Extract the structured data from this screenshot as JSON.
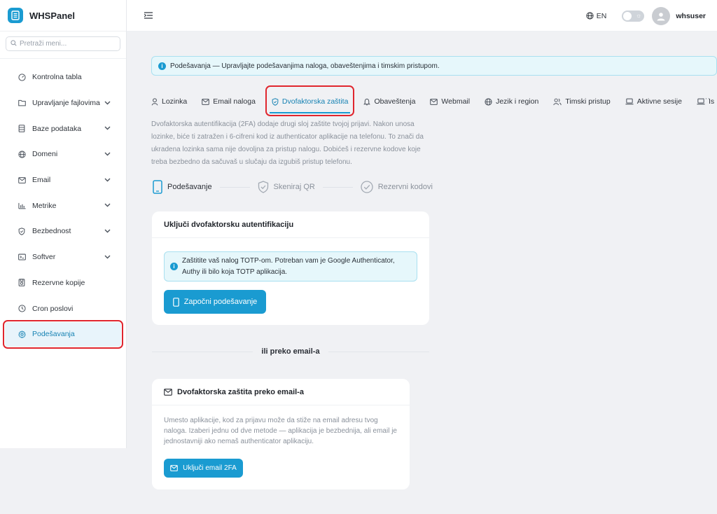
{
  "brand": {
    "name": "WHSPanel"
  },
  "sidebar": {
    "search_placeholder": "Pretraži meni...",
    "items": [
      {
        "label": "Kontrolna tabla",
        "icon": "dashboard-icon",
        "chevron": false
      },
      {
        "label": "Upravljanje fajlovima",
        "icon": "folder-icon",
        "chevron": true
      },
      {
        "label": "Baze podataka",
        "icon": "database-icon",
        "chevron": true
      },
      {
        "label": "Domeni",
        "icon": "globe-icon",
        "chevron": true
      },
      {
        "label": "Email",
        "icon": "mail-icon",
        "chevron": true
      },
      {
        "label": "Metrike",
        "icon": "chart-icon",
        "chevron": true
      },
      {
        "label": "Bezbednost",
        "icon": "shield-icon",
        "chevron": true
      },
      {
        "label": "Softver",
        "icon": "terminal-icon",
        "chevron": true
      },
      {
        "label": "Rezervne kopije",
        "icon": "backup-icon",
        "chevron": false
      },
      {
        "label": "Cron poslovi",
        "icon": "clock-icon",
        "chevron": false
      },
      {
        "label": "Podešavanja",
        "icon": "gear-icon",
        "chevron": false,
        "active": true
      }
    ]
  },
  "topbar": {
    "language": "EN",
    "username": "whsuser"
  },
  "banner": {
    "text": "Podešavanja — Upravljajte podešavanjima naloga, obaveštenjima i timskim pristupom."
  },
  "tabs": [
    {
      "label": "Lozinka",
      "icon": "user-icon"
    },
    {
      "label": "Email naloga",
      "icon": "mail-icon"
    },
    {
      "label": "Dvofaktorska zaštita",
      "icon": "shield-icon",
      "active": true
    },
    {
      "label": "Obaveštenja",
      "icon": "bell-icon"
    },
    {
      "label": "Webmail",
      "icon": "mail-icon"
    },
    {
      "label": "Jezik i region",
      "icon": "globe-icon"
    },
    {
      "label": "Timski pristup",
      "icon": "users-icon"
    },
    {
      "label": "Aktivne sesije",
      "icon": "laptop-icon"
    },
    {
      "label": "Is",
      "icon": "laptop-icon"
    }
  ],
  "tabs_more": "···",
  "description": "Dvofaktorska autentifikacija (2FA) dodaje drugi sloj zaštite tvojoj prijavi. Nakon unosa lozinke, biće ti zatražen i 6-cifreni kod iz authenticator aplikacije na telefonu. To znači da ukradena lozinka sama nije dovoljna za pristup nalogu. Dobićeš i rezervne kodove koje treba bezbedno da sačuvaš u slučaju da izgubiš pristup telefonu.",
  "steps": [
    {
      "label": "Podešavanje",
      "icon": "phone-icon",
      "active": true
    },
    {
      "label": "Skeniraj QR",
      "icon": "shield-check-icon"
    },
    {
      "label": "Rezervni kodovi",
      "icon": "check-circle-icon"
    }
  ],
  "totp_card": {
    "title": "Uključi dvofaktorsku autentifikaciju",
    "alert": "Zaštitite vaš nalog TOTP-om. Potreban vam je Google Authenticator, Authy ili bilo koja TOTP aplikacija.",
    "button": "Započni podešavanje"
  },
  "divider_text": "ili preko email-a",
  "email_card": {
    "title": "Dvofaktorska zaštita preko email-a",
    "body": "Umesto aplikacije, kod za prijavu može da stiže na email adresu tvog naloga. Izaberi jednu od dve metode — aplikacija je bezbednija, ali email je jednostavniji ako nemaš authenticator aplikaciju.",
    "button": "Uključi email 2FA"
  },
  "colors": {
    "accent": "#1a9bd1",
    "highlight": "#e0262e",
    "info_bg": "#e6f7fb"
  }
}
